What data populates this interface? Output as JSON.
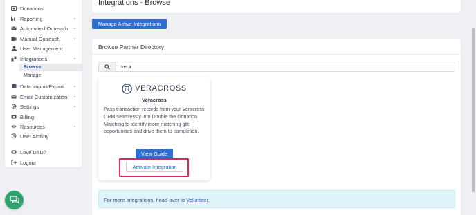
{
  "sidebar": {
    "items": [
      {
        "label": "Donations",
        "icon": "donation-icon",
        "chevron": false
      },
      {
        "label": "Reporting",
        "icon": "bar-chart-icon",
        "chevron": true
      },
      {
        "label": "Automated Outreach",
        "icon": "email-icon",
        "chevron": true
      },
      {
        "label": "Manual Outreach",
        "icon": "outreach-icon",
        "chevron": true
      },
      {
        "label": "User Management",
        "icon": "user-icon",
        "chevron": false
      },
      {
        "label": "Integrations",
        "icon": "integrations-icon",
        "chevron": true
      },
      {
        "label": "Data Import/Export",
        "icon": "database-icon",
        "chevron": true
      },
      {
        "label": "Email Customization",
        "icon": "email-icon",
        "chevron": true
      },
      {
        "label": "Settings",
        "icon": "gear-icon",
        "chevron": true
      },
      {
        "label": "Billing",
        "icon": "billing-icon",
        "chevron": false
      },
      {
        "label": "Resources",
        "icon": "eye-icon",
        "chevron": true
      },
      {
        "label": "User Activity",
        "icon": "history-icon",
        "chevron": false
      },
      {
        "label": "Love DTD?",
        "icon": "heart-icon",
        "chevron": false
      },
      {
        "label": "Logout",
        "icon": "logout-icon",
        "chevron": false
      }
    ],
    "sub_browse": "Browse",
    "sub_manage": "Manage"
  },
  "header": {
    "title": "Integrations - Browse"
  },
  "manage_button": "Manage Active Integrations",
  "browse": {
    "title": "Browse Partner Directory",
    "search_value": "vera"
  },
  "partner": {
    "logo_text": "VERACROSS",
    "name": "Veracross",
    "description": "Pass transaction records from your Veracross CRM seamlessly into Double the Donation Matching to identify more matching gift opportunities and drive them to completion.",
    "view_label": "View Guide",
    "activate_label": "Activate Integration"
  },
  "info": {
    "text": "For more integrations, head over to",
    "link": "Volunteer",
    "suffix": "."
  },
  "colors": {
    "primary": "#2f6ecf",
    "highlight": "#e0245e",
    "chat": "#2ea36b",
    "info_bg": "#dff3fb"
  }
}
